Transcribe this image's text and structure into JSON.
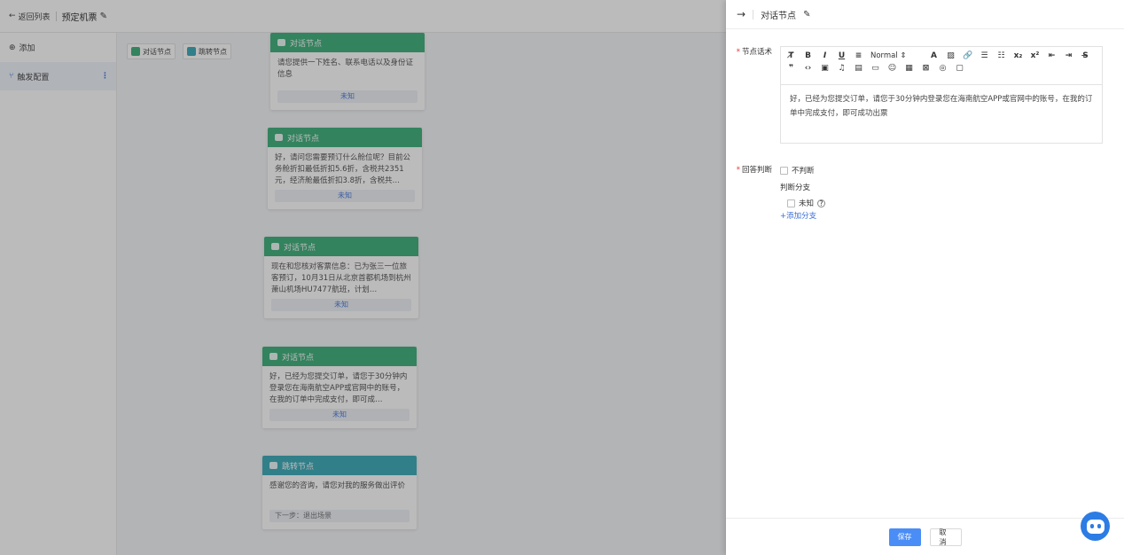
{
  "topbar": {
    "back_label": "返回列表",
    "project_title": "预定机票"
  },
  "sidebar": {
    "add_label": "添加",
    "item_label": "触发配置"
  },
  "canvas": {
    "chip_dialog": "对话节点",
    "chip_jump": "跳转节点",
    "nodes": [
      {
        "title": "对话节点",
        "text": "请您提供一下姓名、联系电话以及身份证信息",
        "tag": "未知"
      },
      {
        "title": "对话节点",
        "text": "好，请问您需要预订什么舱位呢？目前公务舱折扣最低折扣5.6折，含税共2351元，经济舱最低折扣3.8折，含税共…",
        "tag": "未知"
      },
      {
        "title": "对话节点",
        "text": "现在和您核对客票信息：已为张三一位旅客预订，10月31日从北京首都机场到杭州萧山机场HU7477航班，计划…",
        "tag": "未知"
      },
      {
        "title": "对话节点",
        "text": "好，已经为您提交订单，请您于30分钟内登录您在海南航空APP或官网中的账号，在我的订单中完成支付，即可成…",
        "tag": "未知"
      },
      {
        "title": "跳转节点",
        "text": "感谢您的咨询，请您对我的服务做出评价",
        "tag": "下一步：退出场景"
      }
    ]
  },
  "drawer": {
    "title": "对话节点",
    "script_label": "节点话术",
    "font_select": "Normal",
    "editor_text": "好，已经为您提交订单，请您于30分钟内登录您在海南航空APP或官网中的账号，在我的订单中完成支付，即可成功出票",
    "answer_label": "回答判断",
    "no_judge_label": "不判断",
    "branch_label": "判断分支",
    "unknown_label": "未知",
    "add_branch_label": "+添加分支",
    "save_label": "保存",
    "cancel_label": "取消"
  },
  "colors": {
    "dialog_node": "#2fa971",
    "jump_node": "#2ba3b2",
    "primary": "#4b8df6",
    "link": "#3a6fd8"
  }
}
